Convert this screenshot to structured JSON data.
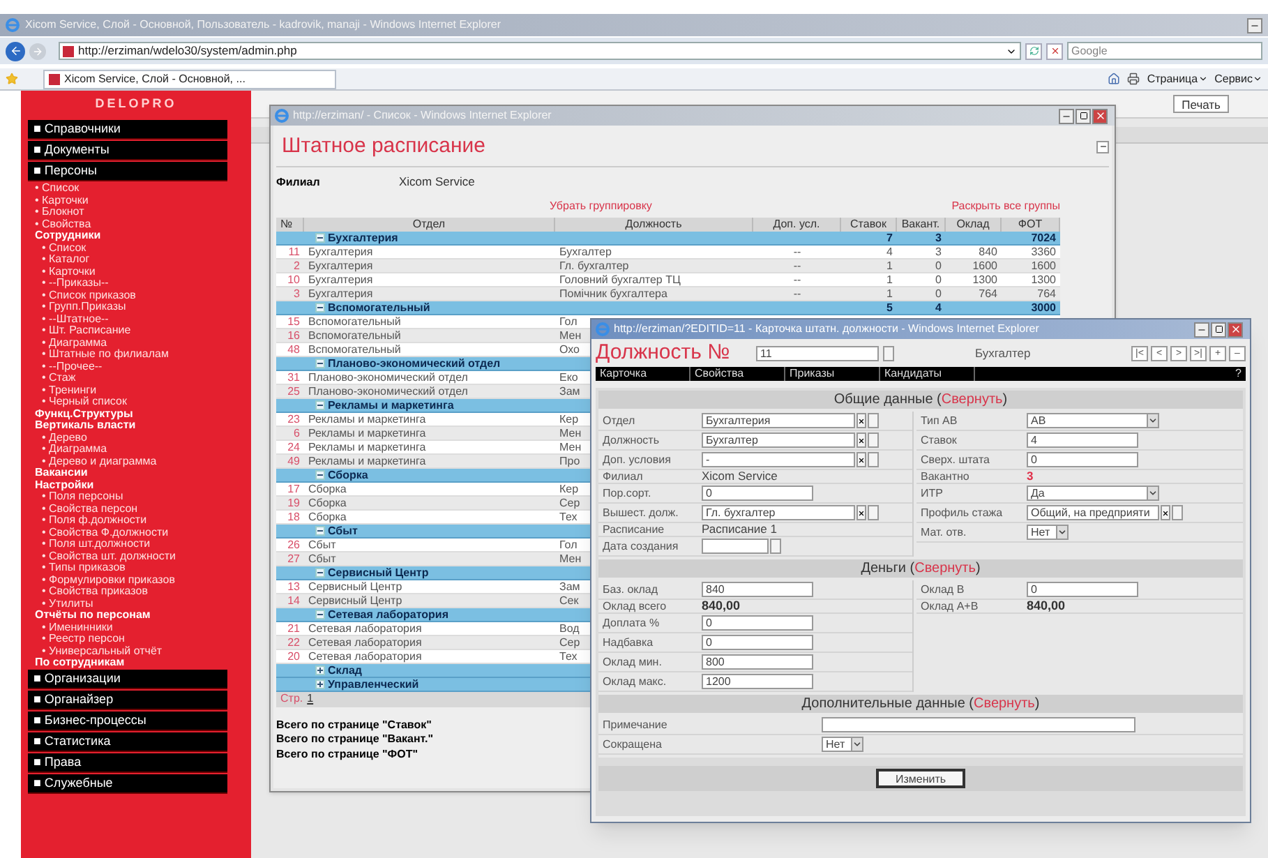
{
  "browser": {
    "title": "Xicom Service, Слой - Основной, Пользователь - kadrovik, manaji - Windows Internet Explorer",
    "address": "http://erziman/wdelo30/system/admin.php",
    "search_placeholder": "Google",
    "tab": "Xicom Service, Слой - Основной, ...",
    "commands": [
      "Страница",
      "Сервис"
    ]
  },
  "background_page": {
    "print_button": "Печать"
  },
  "sidebar": {
    "logo": "DELOPRO",
    "items": [
      {
        "kind": "section",
        "label": "■ Справочники"
      },
      {
        "kind": "section",
        "label": "■ Документы"
      },
      {
        "kind": "section",
        "label": "■ Персоны",
        "children": [
          {
            "kind": "link",
            "label": "• Список"
          },
          {
            "kind": "link",
            "label": "• Карточки"
          },
          {
            "kind": "link",
            "label": "• Блокнот"
          },
          {
            "kind": "link",
            "label": "• Свойства"
          },
          {
            "kind": "heading",
            "label": "Сотрудники",
            "children": [
              {
                "kind": "link",
                "label": "• Список"
              },
              {
                "kind": "link",
                "label": "• Каталог"
              },
              {
                "kind": "link",
                "label": "• Карточки"
              },
              {
                "kind": "link",
                "label": "• --Приказы--"
              },
              {
                "kind": "link",
                "label": "• Список приказов"
              },
              {
                "kind": "link",
                "label": "• Групп.Приказы"
              },
              {
                "kind": "link",
                "label": "• --Штатное--"
              },
              {
                "kind": "link",
                "label": "• Шт. Расписание"
              },
              {
                "kind": "link",
                "label": "• Диаграмма"
              },
              {
                "kind": "link",
                "label": "• Штатные по филиалам"
              },
              {
                "kind": "link",
                "label": "• --Прочее--"
              },
              {
                "kind": "link",
                "label": "• Стаж"
              },
              {
                "kind": "link",
                "label": "• Тренинги"
              },
              {
                "kind": "link",
                "label": "• Черный список"
              }
            ]
          },
          {
            "kind": "heading",
            "label": "Функц.Структуры"
          },
          {
            "kind": "heading",
            "label": "Вертикаль власти",
            "children": [
              {
                "kind": "link",
                "label": "• Дерево"
              },
              {
                "kind": "link",
                "label": "• Диаграмма"
              },
              {
                "kind": "link",
                "label": "• Дерево и диаграмма"
              }
            ]
          },
          {
            "kind": "heading",
            "label": "Вакансии"
          },
          {
            "kind": "heading",
            "label": "Настройки",
            "children": [
              {
                "kind": "link",
                "label": "• Поля персоны"
              },
              {
                "kind": "link",
                "label": "• Свойства персон"
              },
              {
                "kind": "link",
                "label": "• Поля ф.должности"
              },
              {
                "kind": "link",
                "label": "• Свойства Ф.должности"
              },
              {
                "kind": "link",
                "label": "• Поля шт.должности"
              },
              {
                "kind": "link",
                "label": "• Свойства шт. должности"
              },
              {
                "kind": "link",
                "label": "• Типы приказов"
              },
              {
                "kind": "link",
                "label": "• Формулировки приказов"
              },
              {
                "kind": "link",
                "label": "• Свойства приказов"
              },
              {
                "kind": "link",
                "label": "• Утилиты"
              }
            ]
          },
          {
            "kind": "heading",
            "label": "Отчёты по персонам",
            "children": [
              {
                "kind": "link",
                "label": "• Именинники"
              },
              {
                "kind": "link",
                "label": "• Реестр персон"
              },
              {
                "kind": "link",
                "label": "• Универсальный отчёт"
              }
            ]
          },
          {
            "kind": "heading",
            "label": "По сотрудникам"
          }
        ]
      },
      {
        "kind": "section",
        "label": "■ Организации"
      },
      {
        "kind": "section",
        "label": "■ Органайзер"
      },
      {
        "kind": "section",
        "label": "■ Бизнес-процессы"
      },
      {
        "kind": "section",
        "label": "■ Статистика"
      },
      {
        "kind": "section",
        "label": "■ Права"
      },
      {
        "kind": "section",
        "label": "■ Служебные"
      }
    ]
  },
  "list_window": {
    "title": "http://erziman/ - Список - Windows Internet Explorer",
    "heading": "Штатное расписание",
    "filter_label": "Филиал",
    "filter_value": "Xicom Service",
    "links": [
      "Убрать группировку",
      "Раскрыть все группы"
    ],
    "columns": [
      "№",
      "Отдел",
      "Должность",
      "Доп. усл.",
      "Ставок",
      "Вакант.",
      "Оклад",
      "ФОТ"
    ],
    "groups": [
      {
        "name": "Бухгалтерия",
        "expanded": true,
        "totals": {
          "rates": "7",
          "vacant": "3",
          "payroll": "7024"
        },
        "rows": [
          {
            "cells": [
              "11",
              "Бухгалтерия",
              "Бухгалтер",
              "--",
              "4",
              "3",
              "840",
              "3360"
            ]
          },
          {
            "cells": [
              "2",
              "Бухгалтерия",
              "Гл. бухгалтер",
              "--",
              "1",
              "0",
              "1600",
              "1600"
            ]
          },
          {
            "cells": [
              "10",
              "Бухгалтерия",
              "Головний бухгалтер ТЦ",
              "--",
              "1",
              "0",
              "1300",
              "1300"
            ]
          },
          {
            "cells": [
              "3",
              "Бухгалтерия",
              "Помічник бухгалтера",
              "--",
              "1",
              "0",
              "764",
              "764"
            ]
          }
        ]
      },
      {
        "name": "Вспомогательный",
        "expanded": true,
        "totals": {
          "rates": "5",
          "vacant": "4",
          "payroll": "3000"
        },
        "rows": [
          {
            "cells": [
              "15",
              "Вспомогательный",
              "Гол"
            ]
          },
          {
            "cells": [
              "16",
              "Вспомогательный",
              "Мен"
            ]
          },
          {
            "cells": [
              "48",
              "Вспомогательный",
              "Охо"
            ]
          }
        ]
      },
      {
        "name": "Планово-экономический отдел",
        "expanded": true,
        "rows": [
          {
            "cells": [
              "31",
              "Планово-экономический отдел",
              "Еко"
            ]
          },
          {
            "cells": [
              "25",
              "Планово-экономический отдел",
              "Зам"
            ]
          }
        ]
      },
      {
        "name": "Рекламы и маркетинга",
        "expanded": true,
        "rows": [
          {
            "cells": [
              "23",
              "Рекламы и маркетинга",
              "Кер"
            ]
          },
          {
            "cells": [
              "6",
              "Рекламы и маркетинга",
              "Мен"
            ]
          },
          {
            "cells": [
              "24",
              "Рекламы и маркетинга",
              "Мен"
            ]
          },
          {
            "cells": [
              "49",
              "Рекламы и маркетинга",
              "Про"
            ]
          }
        ]
      },
      {
        "name": "Сборка",
        "expanded": true,
        "rows": [
          {
            "cells": [
              "17",
              "Сборка",
              "Кер"
            ]
          },
          {
            "cells": [
              "19",
              "Сборка",
              "Сер"
            ]
          },
          {
            "cells": [
              "18",
              "Сборка",
              "Тех"
            ]
          }
        ]
      },
      {
        "name": "Сбыт",
        "expanded": true,
        "rows": [
          {
            "cells": [
              "26",
              "Сбыт",
              "Гол"
            ]
          },
          {
            "cells": [
              "27",
              "Сбыт",
              "Мен"
            ]
          }
        ]
      },
      {
        "name": "Сервисный Центр",
        "expanded": true,
        "rows": [
          {
            "cells": [
              "13",
              "Сервисный Центр",
              "Зам"
            ]
          },
          {
            "cells": [
              "14",
              "Сервисный Центр",
              "Сек"
            ]
          }
        ]
      },
      {
        "name": "Сетевая лаборатория",
        "expanded": true,
        "rows": [
          {
            "cells": [
              "21",
              "Сетевая лаборатория",
              "Вод"
            ]
          },
          {
            "cells": [
              "22",
              "Сетевая лаборатория",
              "Сер"
            ]
          },
          {
            "cells": [
              "20",
              "Сетевая лаборатория",
              "Тех"
            ]
          }
        ]
      },
      {
        "name": "Склад",
        "expanded": false
      },
      {
        "name": "Управленческий",
        "expanded": false
      }
    ],
    "pager_label": "Стр.",
    "page": "1",
    "summary": [
      "Всего по странице \"Ставок\"",
      "Всего по странице \"Вакант.\"",
      "Всего по странице \"ФОТ\""
    ]
  },
  "card_window": {
    "title": "http://erziman/?EDITID=11 - Карточка штатн. должности - Windows Internet Explorer",
    "heading": "Должность №",
    "number": "11",
    "position": "Бухгалтер",
    "nav": [
      "|<",
      "<",
      ">",
      ">|",
      "+",
      "–"
    ],
    "tabs": [
      "Карточка",
      "Свойства",
      "Приказы",
      "Кандидаты"
    ],
    "help": "?",
    "sections": [
      {
        "title": "Общие данные (",
        "toggle": "Свернуть",
        "title_end": ")",
        "left": [
          {
            "label": "Отдел",
            "kind": "lookup",
            "value": "Бухгалтерия"
          },
          {
            "label": "Должность",
            "kind": "lookup",
            "value": "Бухгалтер"
          },
          {
            "label": "Доп. условия",
            "kind": "lookup",
            "value": "-"
          },
          {
            "label": "Филиал",
            "kind": "text",
            "value": "Xicom Service"
          },
          {
            "label": "Пор.сорт.",
            "kind": "input",
            "value": "0"
          },
          {
            "label": "Вышест. долж.",
            "kind": "lookup",
            "value": "Гл. бухгалтер"
          },
          {
            "label": "Расписание",
            "kind": "text",
            "value": "Расписание 1"
          },
          {
            "label": "Дата создания",
            "kind": "date"
          }
        ],
        "right": [
          {
            "label": "Тип АВ",
            "kind": "select",
            "value": "АВ"
          },
          {
            "label": "Ставок",
            "kind": "input",
            "value": "4"
          },
          {
            "label": "Сверх. штата",
            "kind": "input",
            "value": "0"
          },
          {
            "label": "Вакантно",
            "kind": "alert",
            "value": "3"
          },
          {
            "label": "ИТР",
            "kind": "select",
            "value": "Да"
          },
          {
            "label": "Профиль стажа",
            "kind": "lookup",
            "value": "Общий, на предприяти"
          },
          {
            "label": "Мат. отв.",
            "kind": "select",
            "value": "Нет"
          }
        ]
      },
      {
        "title": "Деньги (",
        "toggle": "Свернуть",
        "title_end": ")",
        "left": [
          {
            "label": "Баз. оклад",
            "kind": "input",
            "value": "840"
          },
          {
            "label": "Оклад всего",
            "kind": "total",
            "value": "840,00"
          },
          {
            "label": "Доплата %",
            "kind": "input",
            "value": "0"
          },
          {
            "label": "Надбавка",
            "kind": "input",
            "value": "0"
          },
          {
            "label": "Оклад мин.",
            "kind": "input",
            "value": "800"
          },
          {
            "label": "Оклад макс.",
            "kind": "input",
            "value": "1200"
          }
        ],
        "right": [
          {
            "label": "Оклад В",
            "kind": "input",
            "value": "0"
          },
          {
            "label": "Оклад А+В",
            "kind": "total",
            "value": "840,00"
          }
        ]
      },
      {
        "title": "Дополнительные данные (",
        "toggle": "Свернуть",
        "title_end": ")",
        "left": [
          {
            "label": "Примечание",
            "kind": "input"
          },
          {
            "label": "Сокращена",
            "kind": "select",
            "value": "Нет"
          }
        ]
      }
    ],
    "submit": "Изменить"
  }
}
